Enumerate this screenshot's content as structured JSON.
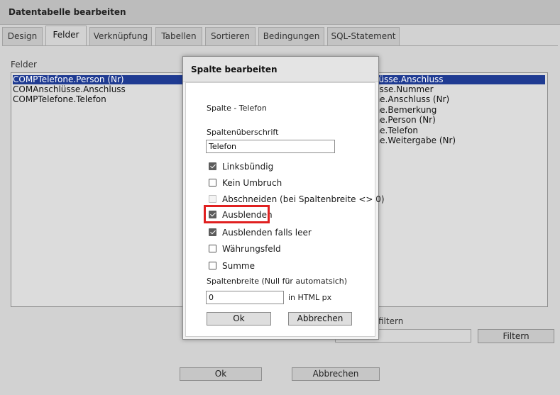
{
  "window": {
    "title": "Datentabelle bearbeiten"
  },
  "tabs": [
    {
      "label": "Design"
    },
    {
      "label": "Felder"
    },
    {
      "label": "Verknüpfung"
    },
    {
      "label": "Tabellen"
    },
    {
      "label": "Sortieren"
    },
    {
      "label": "Bedingungen"
    },
    {
      "label": "SQL-Statement"
    }
  ],
  "felder": {
    "label": "Felder",
    "left_items": [
      "COMPTelefone.Person (Nr)",
      "COMAnschlüsse.Anschluss",
      "COMPTelefone.Telefon"
    ],
    "right_items": [
      "chlüsse.Anschluss",
      "hlüsse.Nummer",
      "fone.Anschluss (Nr)",
      "fone.Bemerkung",
      "fone.Person (Nr)",
      "fone.Telefon",
      "fone.Weitergabe (Nr)"
    ],
    "filter_label": "filtern",
    "filter_value": "",
    "filter_button": "Filtern"
  },
  "footer": {
    "ok": "Ok",
    "cancel": "Abbrechen"
  },
  "dialog": {
    "title": "Spalte bearbeiten",
    "column_label": "Spalte - Telefon",
    "header_label": "Spaltenüberschrift",
    "header_value": "Telefon",
    "checkboxes": [
      {
        "label": "Linksbündig",
        "checked": true,
        "disabled": false
      },
      {
        "label": "Kein Umbruch",
        "checked": false,
        "disabled": false
      },
      {
        "label": "Abschneiden (bei Spaltenbreite <> 0)",
        "checked": false,
        "disabled": true
      },
      {
        "label": "Ausblenden",
        "checked": true,
        "disabled": false
      },
      {
        "label": "Ausblenden falls leer",
        "checked": true,
        "disabled": false
      },
      {
        "label": "Währungsfeld",
        "checked": false,
        "disabled": false
      },
      {
        "label": "Summe",
        "checked": false,
        "disabled": false
      }
    ],
    "width_label": "Spaltenbreite (Null für automatsich)",
    "width_value": "0",
    "width_unit": "in HTML px",
    "ok": "Ok",
    "cancel": "Abbrechen"
  },
  "colors": {
    "highlight": "#e02020",
    "selection": "#1f3b92"
  }
}
